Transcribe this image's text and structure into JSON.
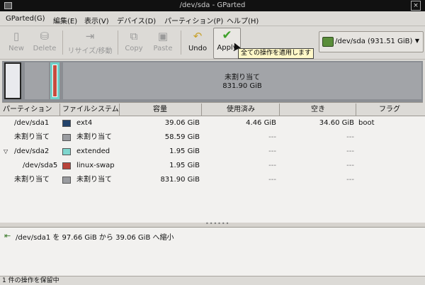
{
  "window": {
    "title": "/dev/sda - GParted"
  },
  "menubar": [
    "GParted(G)",
    "編集(E)",
    "表示(V)",
    "デバイス(D)",
    "パーティション(P)",
    "ヘルプ(H)"
  ],
  "toolbar": {
    "new": "New",
    "delete": "Delete",
    "resize": "リサイズ/移動",
    "copy": "Copy",
    "paste": "Paste",
    "undo": "Undo",
    "apply": "Apply",
    "apply_tooltip": "全ての操作を適用します"
  },
  "device_selector": {
    "label": "/dev/sda  (931.51 GiB)"
  },
  "disk_map": {
    "unallocated_label": "未割り当て",
    "unallocated_size": "831.90 GiB"
  },
  "columns": [
    "パーティション",
    "ファイルシステム",
    "容量",
    "使用済み",
    "空き",
    "フラグ"
  ],
  "partitions": [
    {
      "name": "/dev/sda1",
      "fs": "ext4",
      "color": "#23436b",
      "size": "39.06 GiB",
      "used": "4.46 GiB",
      "free": "34.60 GiB",
      "flags": "boot"
    },
    {
      "name": "未割り当て",
      "fs": "未割り当て",
      "color": "#9a9ca0",
      "size": "58.59 GiB",
      "used": "---",
      "free": "---",
      "flags": ""
    },
    {
      "name": "/dev/sda2",
      "fs": "extended",
      "color": "#7fd6ce",
      "size": "1.95 GiB",
      "used": "---",
      "free": "---",
      "flags": ""
    },
    {
      "name": "/dev/sda5",
      "fs": "linux-swap",
      "color": "#b8433a",
      "size": "1.95 GiB",
      "used": "---",
      "free": "---",
      "flags": ""
    },
    {
      "name": "未割り当て",
      "fs": "未割り当て",
      "color": "#9a9ca0",
      "size": "831.90 GiB",
      "used": "---",
      "free": "---",
      "flags": ""
    }
  ],
  "pending_ops": [
    "/dev/sda1 を 97.66 GiB から 39.06 GiB へ縮小"
  ],
  "status": "1 件の操作を保留中"
}
